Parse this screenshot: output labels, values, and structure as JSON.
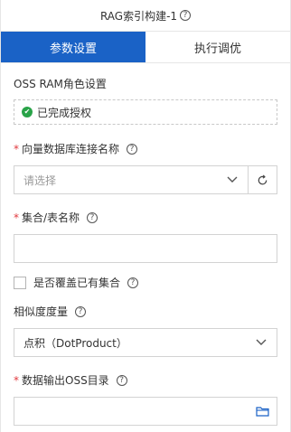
{
  "header": {
    "title": "RAG索引构建-1",
    "help_glyph": "?"
  },
  "tabs": [
    {
      "label": "参数设置",
      "active": true
    },
    {
      "label": "执行调优",
      "active": false
    }
  ],
  "oss": {
    "label": "OSS RAM角色设置",
    "status": "已完成授权"
  },
  "vector_db": {
    "label": "向量数据库连接名称",
    "placeholder": "请选择"
  },
  "collection": {
    "label": "集合/表名称",
    "value": ""
  },
  "overwrite": {
    "label": "是否覆盖已有集合",
    "checked": false
  },
  "similarity": {
    "label": "相似度度量",
    "value": "点积（DotProduct）"
  },
  "output_dir": {
    "label": "数据输出OSS目录",
    "value": ""
  },
  "colors": {
    "accent": "#1a62c6",
    "required": "#e0393e",
    "success": "#29a348"
  }
}
